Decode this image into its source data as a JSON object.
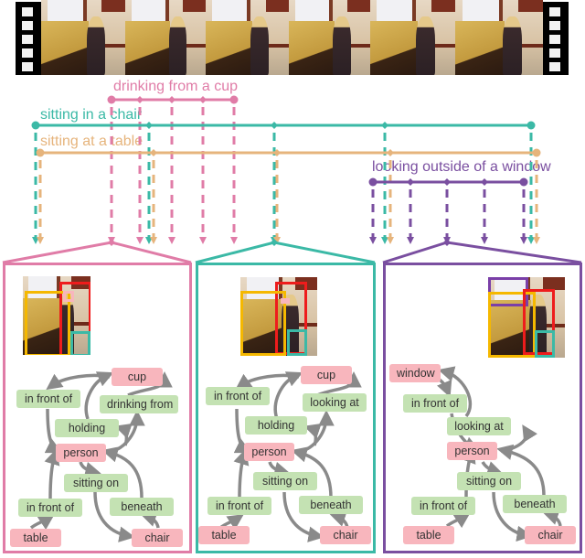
{
  "video_strip": {
    "frame_count": 6,
    "icon": "film-strip-icon"
  },
  "actions": [
    {
      "id": "drinking",
      "label": "drinking from a cup",
      "color": "#e07ca7"
    },
    {
      "id": "chair",
      "label": "sitting in a chair",
      "color": "#3bb9a6"
    },
    {
      "id": "table",
      "label": "sitting at a table",
      "color": "#e6b47c"
    },
    {
      "id": "window",
      "label": "looking outside of a window",
      "color": "#7a4fa0"
    }
  ],
  "panels": [
    {
      "id": "drinking",
      "border_color": "#e07ca7",
      "boxes": [
        "person",
        "table",
        "chair",
        "cup"
      ],
      "objects": {
        "cup": "cup",
        "person": "person",
        "table": "table",
        "chair": "chair"
      },
      "relations": {
        "in_front_of_top": "in front of",
        "action": "drinking from",
        "holding": "holding",
        "sitting_on": "sitting on",
        "in_front_of_bottom": "in front of",
        "beneath": "beneath"
      }
    },
    {
      "id": "chair",
      "border_color": "#3bb9a6",
      "boxes": [
        "person",
        "table",
        "chair",
        "cup"
      ],
      "objects": {
        "cup": "cup",
        "person": "person",
        "table": "table",
        "chair": "chair"
      },
      "relations": {
        "in_front_of_top": "in front of",
        "action": "looking at",
        "holding": "holding",
        "sitting_on": "sitting on",
        "in_front_of_bottom": "in front of",
        "beneath": "beneath"
      }
    },
    {
      "id": "window",
      "border_color": "#7a4fa0",
      "boxes": [
        "person",
        "table",
        "chair",
        "window"
      ],
      "objects": {
        "window": "window",
        "person": "person",
        "table": "table",
        "chair": "chair"
      },
      "relations": {
        "in_front_of_top": "in front of",
        "action": "looking at",
        "sitting_on": "sitting on",
        "in_front_of_bottom": "in front of",
        "beneath": "beneath"
      }
    }
  ],
  "bbox_colors": {
    "person": "#ee1c1c",
    "table": "#f5b800",
    "chair": "#3bb9a6",
    "cup": "#f8b6bd",
    "window": "#7a3fa8"
  },
  "node_colors": {
    "object": "#f8b6bd",
    "relation": "#c4e2b3",
    "edge": "#8a8a8a"
  }
}
